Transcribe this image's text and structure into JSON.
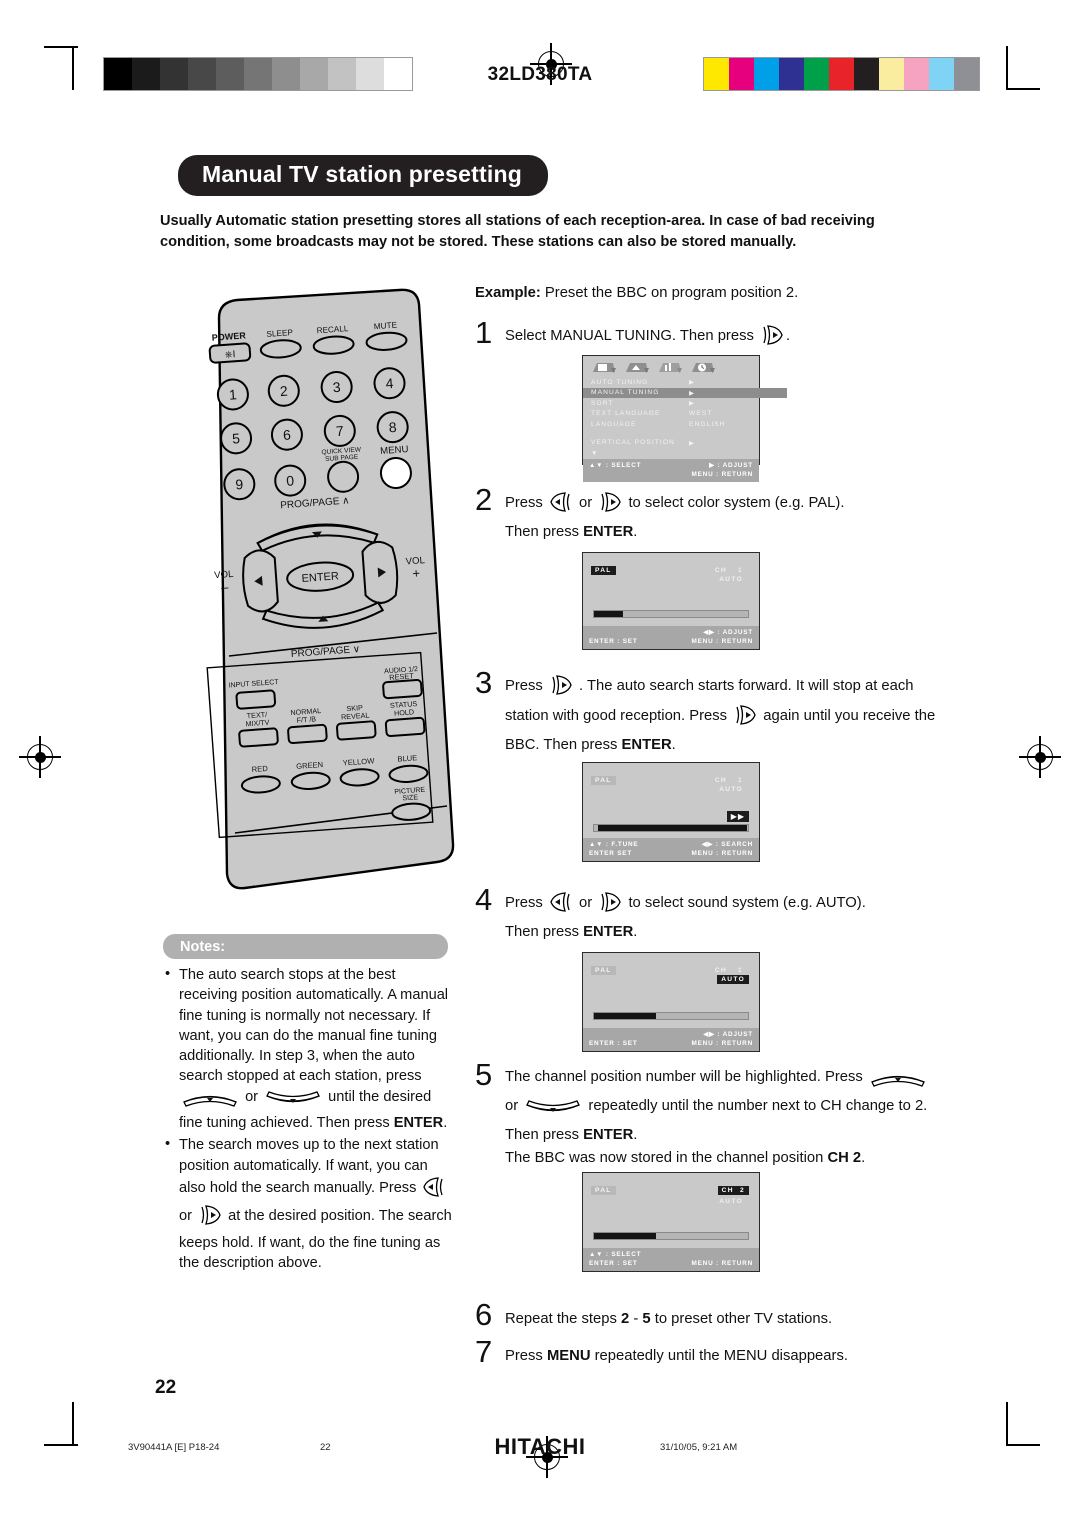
{
  "header": {
    "model": "32LD380TA",
    "grey_steps": [
      "#000000",
      "#1b1b1b",
      "#333333",
      "#484848",
      "#5d5d5d",
      "#757575",
      "#8e8e8e",
      "#a8a8a8",
      "#c2c2c2",
      "#dddddd",
      "#ffffff"
    ],
    "color_steps": [
      "#ffe800",
      "#e6007e",
      "#00a0e9",
      "#2e3192",
      "#00a04a",
      "#e8232a",
      "#231f20",
      "#faeda0",
      "#f5a3c0",
      "#7fd4f5",
      "#8e9095"
    ]
  },
  "title": "Manual TV station presetting",
  "intro": "Usually Automatic station presetting stores all stations of each reception-area. In case of bad receiving condition, some broadcasts may not be stored. These stations can also be stored manually.",
  "remote": {
    "top_labels": [
      "POWER",
      "SLEEP",
      "RECALL",
      "MUTE"
    ],
    "numbers": [
      "1",
      "2",
      "3",
      "4",
      "5",
      "6",
      "7",
      "8",
      "9",
      "0"
    ],
    "quick_view": "QUICK VIEW",
    "sub_page": "SUB PAGE",
    "menu": "MENU",
    "prog_page_up": "PROG/PAGE",
    "prog_page_down": "PROG/PAGE",
    "vol_label": "VOL",
    "vol_minus": "–",
    "vol_plus": "+",
    "enter": "ENTER",
    "input_select": "INPUT SELECT",
    "audio_12": "AUDIO 1/2",
    "reset": "RESET",
    "text_mix": [
      "TEXT/",
      "MIX/TV"
    ],
    "normal_ftb": [
      "NORMAL",
      "F/T /B"
    ],
    "skip_reveal": [
      "SKIP",
      "REVEAL"
    ],
    "status_hold": [
      "STATUS",
      "HOLD"
    ],
    "color_buttons": [
      "RED",
      "GREEN",
      "YELLOW",
      "BLUE"
    ],
    "picture_size": [
      "PICTURE",
      "SIZE"
    ]
  },
  "notes": {
    "heading": "Notes:",
    "items": [
      {
        "part1": "The auto search stops at the best receiving position automatically. A manual fine tuning is normally not necessary. If want, you can do the manual fine tuning additionally. In step 3, when the auto search stopped at each station, press",
        "mid": "or",
        "part2": "until the desired fine tuning achieved.",
        "part3": "Then press ",
        "part3b": "ENTER",
        "part3c": "."
      },
      {
        "part1": "The search moves up to the next station position automatically. If want, you can also hold the search manually. Press",
        "mid": "or",
        "part2": "at the desired position. The search keeps hold. If want, do the fine tuning as the description above."
      }
    ]
  },
  "example": {
    "label": "Example:",
    "text": " Preset the BBC on program position 2."
  },
  "steps": [
    {
      "num": "1",
      "a": "Select MANUAL TUNING. Then press ",
      "b": "."
    },
    {
      "num": "2",
      "a": "Press ",
      "mid": " or ",
      "b": " to select color system (e.g. PAL).",
      "line2a": "Then press ",
      "line2b": "ENTER",
      "line2c": "."
    },
    {
      "num": "3",
      "a": "Press ",
      "b": " . The auto search starts forward. It will stop at each station with good reception. Press ",
      "c": " again until you receive the BBC. Then press ",
      "d": "ENTER",
      "e": "."
    },
    {
      "num": "4",
      "a": "Press ",
      "mid": " or ",
      "b": " to select sound system (e.g. AUTO).",
      "line2a": "Then press ",
      "line2b": "ENTER",
      "line2c": "."
    },
    {
      "num": "5",
      "a": "The channel position number will be highlighted. Press ",
      "mid": " or ",
      "b": " repeatedly until the number next to CH change to 2. Then press ",
      "c": "ENTER",
      "d": ".",
      "line3a": "The BBC was now stored in the channel position ",
      "line3b": "CH 2",
      "line3c": "."
    },
    {
      "num": "6",
      "a": "Repeat the steps ",
      "b": "2",
      "c": " - ",
      "d": "5",
      "e": " to preset other TV stations."
    },
    {
      "num": "7",
      "a": "Press ",
      "b": "MENU",
      "c": " repeatedly until the MENU disappears."
    }
  ],
  "osd": {
    "screen1": {
      "rows": [
        {
          "label": "AUTO TUNING",
          "value": "▶",
          "selected": false
        },
        {
          "label": "MANUAL TUNING",
          "value": "▶",
          "selected": true
        },
        {
          "label": "SORT",
          "value": "▶",
          "selected": false
        },
        {
          "label": "TEXT LANGUAGE",
          "value": "WEST",
          "selected": false
        },
        {
          "label": "LANGUAGE",
          "value": "ENGLISH",
          "selected": false
        }
      ],
      "extra_label": "VERTICAL POSITION",
      "extra_value": "▶",
      "down_marker": "▼",
      "foot_left": "▲▼ : SELECT",
      "foot_right_1": "▶ : ADJUST",
      "foot_right_2": "MENU : RETURN"
    },
    "screen2": {
      "system": "PAL",
      "ch_label": "CH",
      "ch_value": "1",
      "sound": "AUTO",
      "bar_percent": 19,
      "foot_left": "ENTER : SET",
      "foot_right_1": "◀▶ : ADJUST",
      "foot_right_2": "MENU : RETURN"
    },
    "screen3": {
      "system": "PAL",
      "ch_label": "CH",
      "ch_value": "1",
      "sound": "AUTO",
      "bar_percent": 97,
      "ff_marker": "▶▶",
      "foot_left_1": "▲▼ : F.TUNE",
      "foot_left_2": "ENTER SET",
      "foot_right_1": "◀▶ : SEARCH",
      "foot_right_2": "MENU : RETURN"
    },
    "screen4": {
      "system": "PAL",
      "ch_label": "CH",
      "ch_value": "1",
      "sound": "AUTO",
      "bar_percent": 40,
      "foot_left": "ENTER : SET",
      "foot_right_1": "◀▶ : ADJUST",
      "foot_right_2": "MENU : RETURN"
    },
    "screen5": {
      "system": "PAL",
      "ch_label": "CH",
      "ch_value": "2",
      "sound": "AUTO",
      "bar_percent": 40,
      "foot_left_1": "▲▼ : SELECT",
      "foot_left_2": "ENTER : SET",
      "foot_right": "MENU : RETURN"
    }
  },
  "page_number": "22",
  "footer": {
    "doc_code": "3V90441A [E] P18-24",
    "page": "22",
    "brand": "HITACHI",
    "timestamp": "31/10/05, 9:21 AM"
  }
}
